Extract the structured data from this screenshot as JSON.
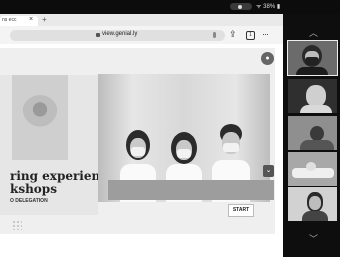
{
  "status": {
    "text": "ᯤ 38% ▮"
  },
  "browser": {
    "tab_title": "ns ecc",
    "url": "view.genial.ly"
  },
  "slide": {
    "title_line1": "ring experiences",
    "title_line2": "kshops",
    "subtitle": "O DELEGATION",
    "start_label": "START"
  }
}
